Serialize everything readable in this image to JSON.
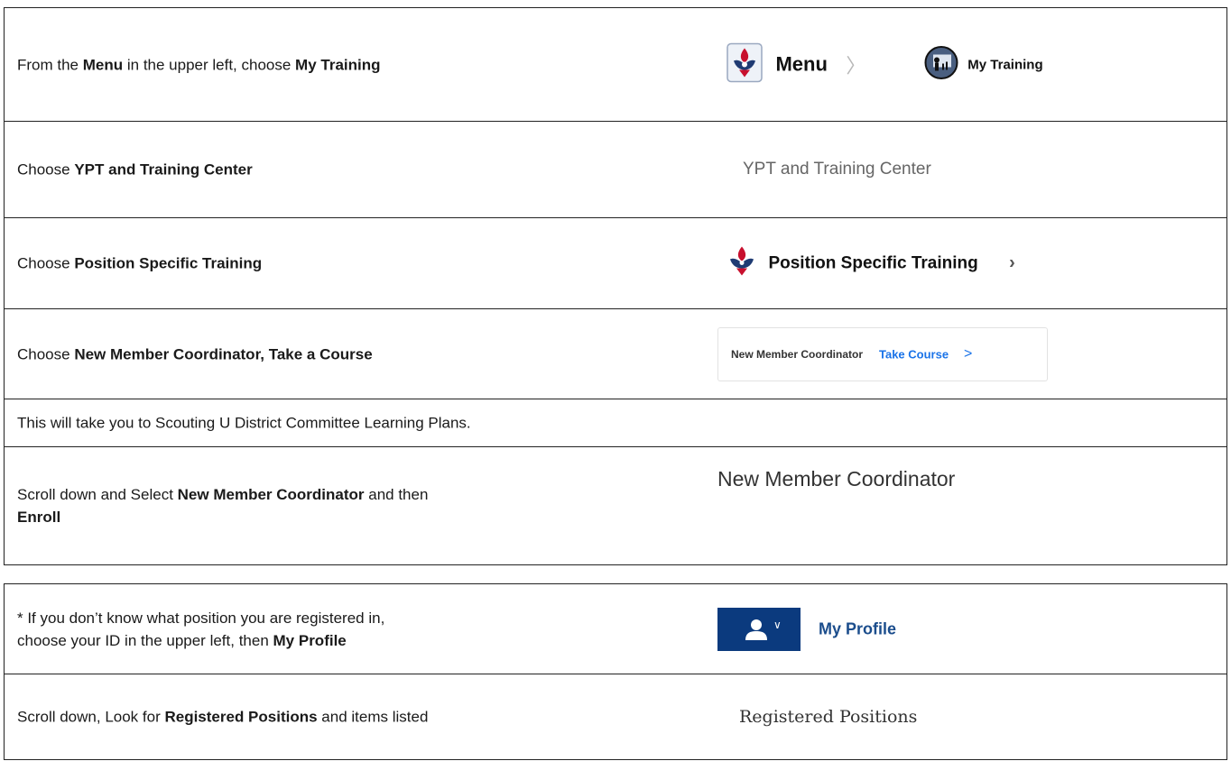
{
  "section1": {
    "row1": {
      "text_before": "From the ",
      "menu_bold": "Menu",
      "text_mid": " in the upper left, choose ",
      "training_bold": "My Training",
      "visual_menu_label": "Menu",
      "visual_training_label": "My Training"
    },
    "row2": {
      "text_before": "Choose ",
      "bold": "YPT and Training Center",
      "visual_label": "YPT and Training Center"
    },
    "row3": {
      "text_before": "Choose ",
      "bold": "Position Specific Training",
      "visual_label": "Position Specific Training"
    },
    "row4": {
      "text_before": "Choose ",
      "bold": "New Member Coordinator, Take a Course",
      "course_name": "New Member Coordinator",
      "take_course": "Take Course"
    },
    "row5": {
      "text": "This will take you to Scouting U District Committee Learning Plans."
    },
    "row6": {
      "text_before": "Scroll down and Select ",
      "bold1": "New Member Coordinator",
      "text_mid": " and then ",
      "bold2": "Enroll",
      "visual_label": "New Member Coordinator"
    }
  },
  "section2": {
    "row1": {
      "text_line1": "* If you don’t know what position you are registered in,",
      "text_line2_before": "choose your ID in the upper left, then ",
      "bold": "My Profile",
      "profile_link": "My Profile"
    },
    "row2": {
      "text_before": "Scroll down, Look for ",
      "bold": "Registered Positions",
      "text_after": " and items listed",
      "visual_label": "Registered Positions"
    }
  },
  "colors": {
    "border": "#222222",
    "link_blue": "#1a73e8",
    "profile_blue": "#0b3a7e",
    "profile_text": "#1b4d8c"
  }
}
